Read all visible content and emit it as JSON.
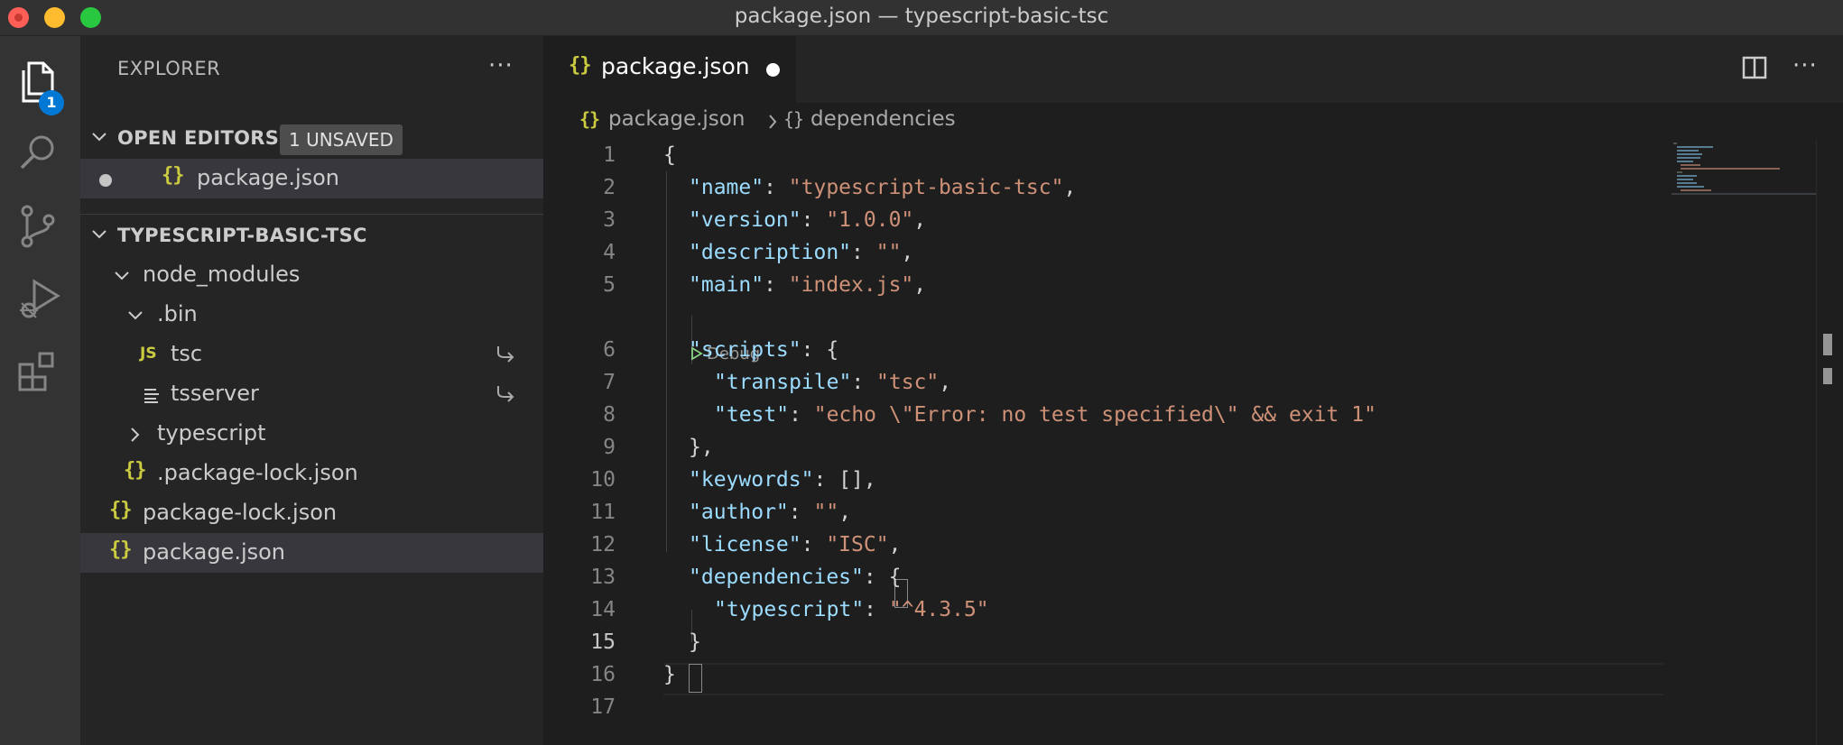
{
  "window": {
    "title": "package.json — typescript-basic-tsc"
  },
  "activity_bar": {
    "explorer_badge": "1",
    "items": [
      "explorer",
      "search",
      "source-control",
      "run-and-debug",
      "extensions"
    ]
  },
  "sidebar": {
    "header": "EXPLORER",
    "more": "···",
    "open_editors": {
      "title": "OPEN EDITORS",
      "badge": "1 UNSAVED",
      "files": [
        {
          "name": "package.json",
          "icon": "json-icon",
          "dirty": true
        }
      ]
    },
    "project": {
      "title": "TYPESCRIPT-BASIC-TSC",
      "tree": [
        {
          "label": "node_modules",
          "kind": "folder-open"
        },
        {
          "label": ".bin",
          "kind": "folder-open"
        },
        {
          "label": "tsc",
          "icon": "JS",
          "kind": "symlink"
        },
        {
          "label": "tsserver",
          "kind": "symlink"
        },
        {
          "label": "typescript",
          "kind": "folder-closed"
        },
        {
          "label": ".package-lock.json",
          "icon": "json-icon"
        },
        {
          "label": "package-lock.json",
          "icon": "json-icon"
        },
        {
          "label": "package.json",
          "icon": "json-icon",
          "selected": true
        }
      ]
    }
  },
  "editor": {
    "tab": {
      "label": "package.json",
      "dirty": true
    },
    "more": "···",
    "breadcrumb": {
      "file": "package.json",
      "symbol": "dependencies"
    },
    "codelens": "Debug",
    "active_line": 15,
    "line_numbers": [
      "1",
      "2",
      "3",
      "4",
      "5",
      "6",
      "7",
      "8",
      "9",
      "10",
      "11",
      "12",
      "13",
      "14",
      "15",
      "16",
      "17"
    ],
    "lines": [
      {
        "p1": "{"
      },
      {
        "k": "\"name\"",
        "p1": ": ",
        "s": "\"typescript-basic-tsc\"",
        "p2": ","
      },
      {
        "k": "\"version\"",
        "p1": ": ",
        "s": "\"1.0.0\"",
        "p2": ","
      },
      {
        "k": "\"description\"",
        "p1": ": ",
        "s": "\"\"",
        "p2": ","
      },
      {
        "k": "\"main\"",
        "p1": ": ",
        "s": "\"index.js\"",
        "p2": ","
      },
      {
        "k": "\"scripts\"",
        "p1": ": {"
      },
      {
        "k": "\"transpile\"",
        "p1": ": ",
        "s": "\"tsc\"",
        "p2": ","
      },
      {
        "k": "\"test\"",
        "p1": ": ",
        "s": "\"echo \\\"Error: no test specified\\\" && exit 1\""
      },
      {
        "p1": "},"
      },
      {
        "k": "\"keywords\"",
        "p1": ": [],"
      },
      {
        "k": "\"author\"",
        "p1": ": ",
        "s": "\"\"",
        "p2": ","
      },
      {
        "k": "\"license\"",
        "p1": ": ",
        "s": "\"ISC\"",
        "p2": ","
      },
      {
        "k": "\"dependencies\"",
        "p1": ": {"
      },
      {
        "k": "\"typescript\"",
        "p1": ": ",
        "s": "\"^4.3.5\""
      },
      {
        "p1": "}"
      },
      {
        "p1": "}"
      },
      {
        "p1": ""
      }
    ]
  }
}
